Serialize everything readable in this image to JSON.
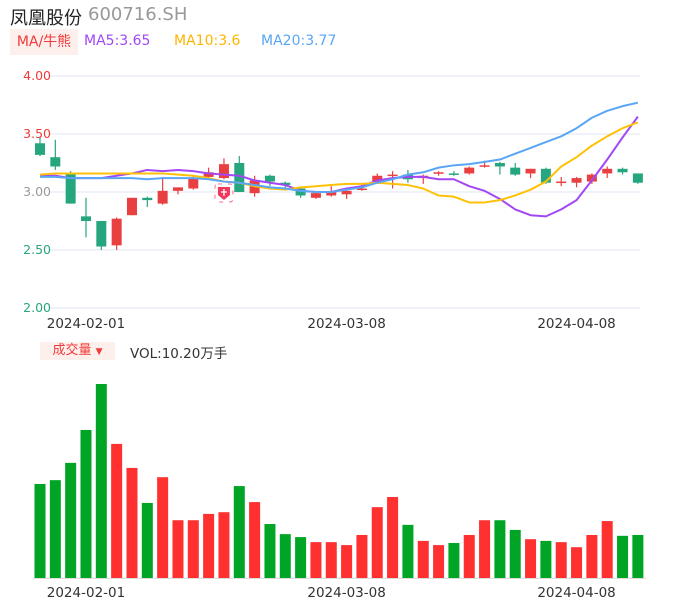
{
  "header": {
    "name": "凤凰股份",
    "code": "600716.SH",
    "ma_button": "MA/牛熊",
    "ma5": "MA5:3.65",
    "ma10": "MA10:3.6",
    "ma20": "MA20:3.77"
  },
  "volume_panel": {
    "button": "成交量",
    "vol_text": "VOL:10.20万手"
  },
  "colors": {
    "up": "#e84040",
    "down": "#26a67e",
    "vol_up": "#fe3030",
    "vol_down": "#00a526",
    "ma5": "#a347f5",
    "ma10": "#ffc107",
    "ma20": "#5aa6f5",
    "grid": "#dfe4f2"
  },
  "chart_data": {
    "type": "candlestick",
    "ylim": [
      2.0,
      4.0
    ],
    "yticks": [
      {
        "v": 4.0,
        "label": "4.00",
        "color": "#f03a3a"
      },
      {
        "v": 3.5,
        "label": "3.50",
        "color": "#f03a3a"
      },
      {
        "v": 3.0,
        "label": "3.00",
        "color": "#999999"
      },
      {
        "v": 2.5,
        "label": "2.50",
        "color": "#26a67e"
      },
      {
        "v": 2.0,
        "label": "2.00",
        "color": "#26a67e"
      }
    ],
    "x_labels": [
      {
        "index": 3,
        "label": "2024-02-01"
      },
      {
        "index": 20,
        "label": "2024-03-08"
      },
      {
        "index": 35,
        "label": "2024-04-08"
      }
    ],
    "marker_index": 12,
    "ohlc": [
      [
        3.42,
        3.47,
        3.31,
        3.32
      ],
      [
        3.3,
        3.45,
        3.19,
        3.22
      ],
      [
        3.16,
        3.18,
        2.9,
        2.9
      ],
      [
        2.79,
        2.95,
        2.61,
        2.75
      ],
      [
        2.75,
        2.75,
        2.5,
        2.53
      ],
      [
        2.54,
        2.78,
        2.5,
        2.77
      ],
      [
        2.8,
        2.95,
        2.8,
        2.95
      ],
      [
        2.95,
        2.96,
        2.87,
        2.93
      ],
      [
        2.9,
        3.13,
        2.89,
        3.01
      ],
      [
        3.01,
        3.04,
        2.98,
        3.04
      ],
      [
        3.03,
        3.14,
        3.02,
        3.12
      ],
      [
        3.13,
        3.21,
        3.12,
        3.17
      ],
      [
        3.12,
        3.29,
        3.11,
        3.24
      ],
      [
        3.25,
        3.31,
        3.0,
        3.0
      ],
      [
        2.99,
        3.14,
        2.96,
        3.1
      ],
      [
        3.14,
        3.15,
        3.05,
        3.09
      ],
      [
        3.08,
        3.09,
        3.02,
        3.06
      ],
      [
        3.03,
        3.04,
        2.95,
        2.97
      ],
      [
        2.95,
        3.0,
        2.94,
        2.99
      ],
      [
        2.97,
        3.05,
        2.96,
        3.0
      ],
      [
        2.98,
        3.02,
        2.94,
        3.01
      ],
      [
        3.02,
        3.06,
        3.01,
        3.03
      ],
      [
        3.08,
        3.16,
        3.07,
        3.14
      ],
      [
        3.14,
        3.18,
        3.03,
        3.15
      ],
      [
        3.15,
        3.19,
        3.08,
        3.11
      ],
      [
        3.12,
        3.15,
        3.07,
        3.14
      ],
      [
        3.16,
        3.18,
        3.14,
        3.17
      ],
      [
        3.16,
        3.18,
        3.14,
        3.155
      ],
      [
        3.16,
        3.22,
        3.15,
        3.21
      ],
      [
        3.22,
        3.27,
        3.21,
        3.23
      ],
      [
        3.25,
        3.26,
        3.15,
        3.22
      ],
      [
        3.21,
        3.25,
        3.14,
        3.15
      ],
      [
        3.16,
        3.2,
        3.12,
        3.2
      ],
      [
        3.2,
        3.21,
        3.07,
        3.08
      ],
      [
        3.08,
        3.13,
        3.05,
        3.09
      ],
      [
        3.08,
        3.13,
        3.04,
        3.12
      ],
      [
        3.09,
        3.16,
        3.07,
        3.15
      ],
      [
        3.16,
        3.22,
        3.12,
        3.2
      ],
      [
        3.2,
        3.21,
        3.15,
        3.17
      ],
      [
        3.16,
        3.16,
        3.07,
        3.08
      ]
    ],
    "ma5": [
      3.14,
      3.14,
      3.12,
      3.12,
      3.12,
      3.14,
      3.16,
      3.19,
      3.18,
      3.19,
      3.18,
      3.16,
      3.15,
      3.14,
      3.1,
      3.08,
      3.06,
      3.01,
      3.0,
      3.0,
      3.03,
      3.05,
      3.1,
      3.12,
      3.13,
      3.13,
      3.11,
      3.11,
      3.05,
      3.01,
      2.94,
      2.85,
      2.8,
      2.79,
      2.85,
      2.93,
      3.1,
      3.28,
      3.47,
      3.65
    ],
    "ma10": [
      3.15,
      3.16,
      3.16,
      3.16,
      3.16,
      3.16,
      3.16,
      3.16,
      3.16,
      3.15,
      3.14,
      3.12,
      3.09,
      3.08,
      3.05,
      3.03,
      3.02,
      3.04,
      3.05,
      3.06,
      3.07,
      3.07,
      3.08,
      3.07,
      3.06,
      3.03,
      2.97,
      2.96,
      2.91,
      2.91,
      2.93,
      2.97,
      3.02,
      3.09,
      3.22,
      3.3,
      3.4,
      3.48,
      3.55,
      3.6
    ],
    "ma20": [
      3.13,
      3.13,
      3.12,
      3.12,
      3.12,
      3.12,
      3.12,
      3.11,
      3.12,
      3.12,
      3.12,
      3.11,
      3.09,
      3.08,
      3.06,
      3.04,
      3.03,
      3.01,
      3.0,
      3.0,
      3.02,
      3.04,
      3.08,
      3.11,
      3.15,
      3.17,
      3.21,
      3.23,
      3.24,
      3.26,
      3.28,
      3.33,
      3.38,
      3.43,
      3.48,
      3.55,
      3.64,
      3.7,
      3.74,
      3.77
    ],
    "volume_unit": "万手",
    "volume": [
      22.3,
      23.2,
      27.3,
      35.1,
      46.0,
      31.8,
      26.1,
      17.8,
      23.9,
      13.7,
      13.7,
      15.2,
      15.6,
      21.8,
      18.0,
      12.8,
      10.4,
      9.7,
      8.5,
      8.5,
      7.8,
      10.2,
      16.8,
      19.2,
      12.6,
      8.8,
      7.8,
      8.3,
      10.2,
      13.7,
      13.7,
      11.4,
      9.2,
      8.8,
      8.5,
      7.3,
      10.2,
      13.5,
      10.0,
      10.2
    ]
  }
}
